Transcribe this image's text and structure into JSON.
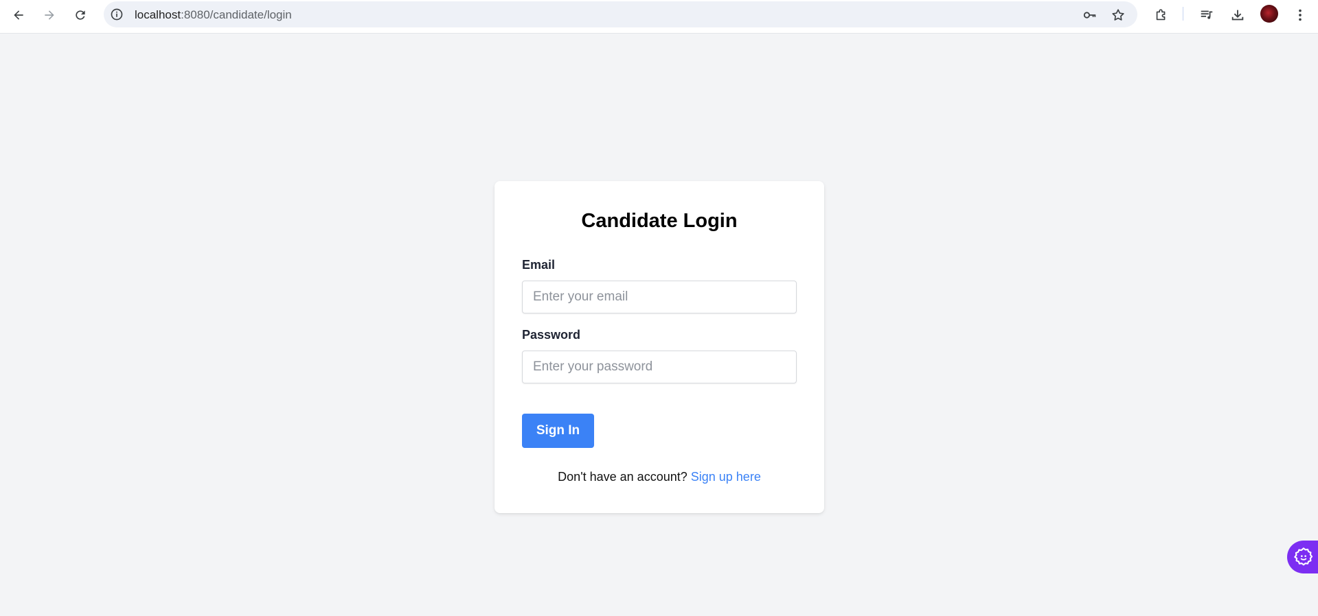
{
  "browser": {
    "url_host": "localhost",
    "url_path": ":8080/candidate/login"
  },
  "login": {
    "title": "Candidate Login",
    "email_label": "Email",
    "email_placeholder": "Enter your email",
    "email_value": "",
    "password_label": "Password",
    "password_placeholder": "Enter your password",
    "password_value": "",
    "submit_label": "Sign In",
    "signup_prompt": "Don't have an account? ",
    "signup_link": "Sign up here"
  },
  "colors": {
    "page_background": "#f3f4f6",
    "primary": "#3b82f6",
    "widget": "#7c2ef2"
  },
  "icons": [
    "back-arrow-icon",
    "forward-arrow-icon",
    "reload-icon",
    "site-info-icon",
    "password-key-icon",
    "bookmark-star-icon",
    "extensions-icon",
    "media-queue-icon",
    "download-icon",
    "profile-avatar",
    "more-vert-icon",
    "settings-gear-icon"
  ]
}
